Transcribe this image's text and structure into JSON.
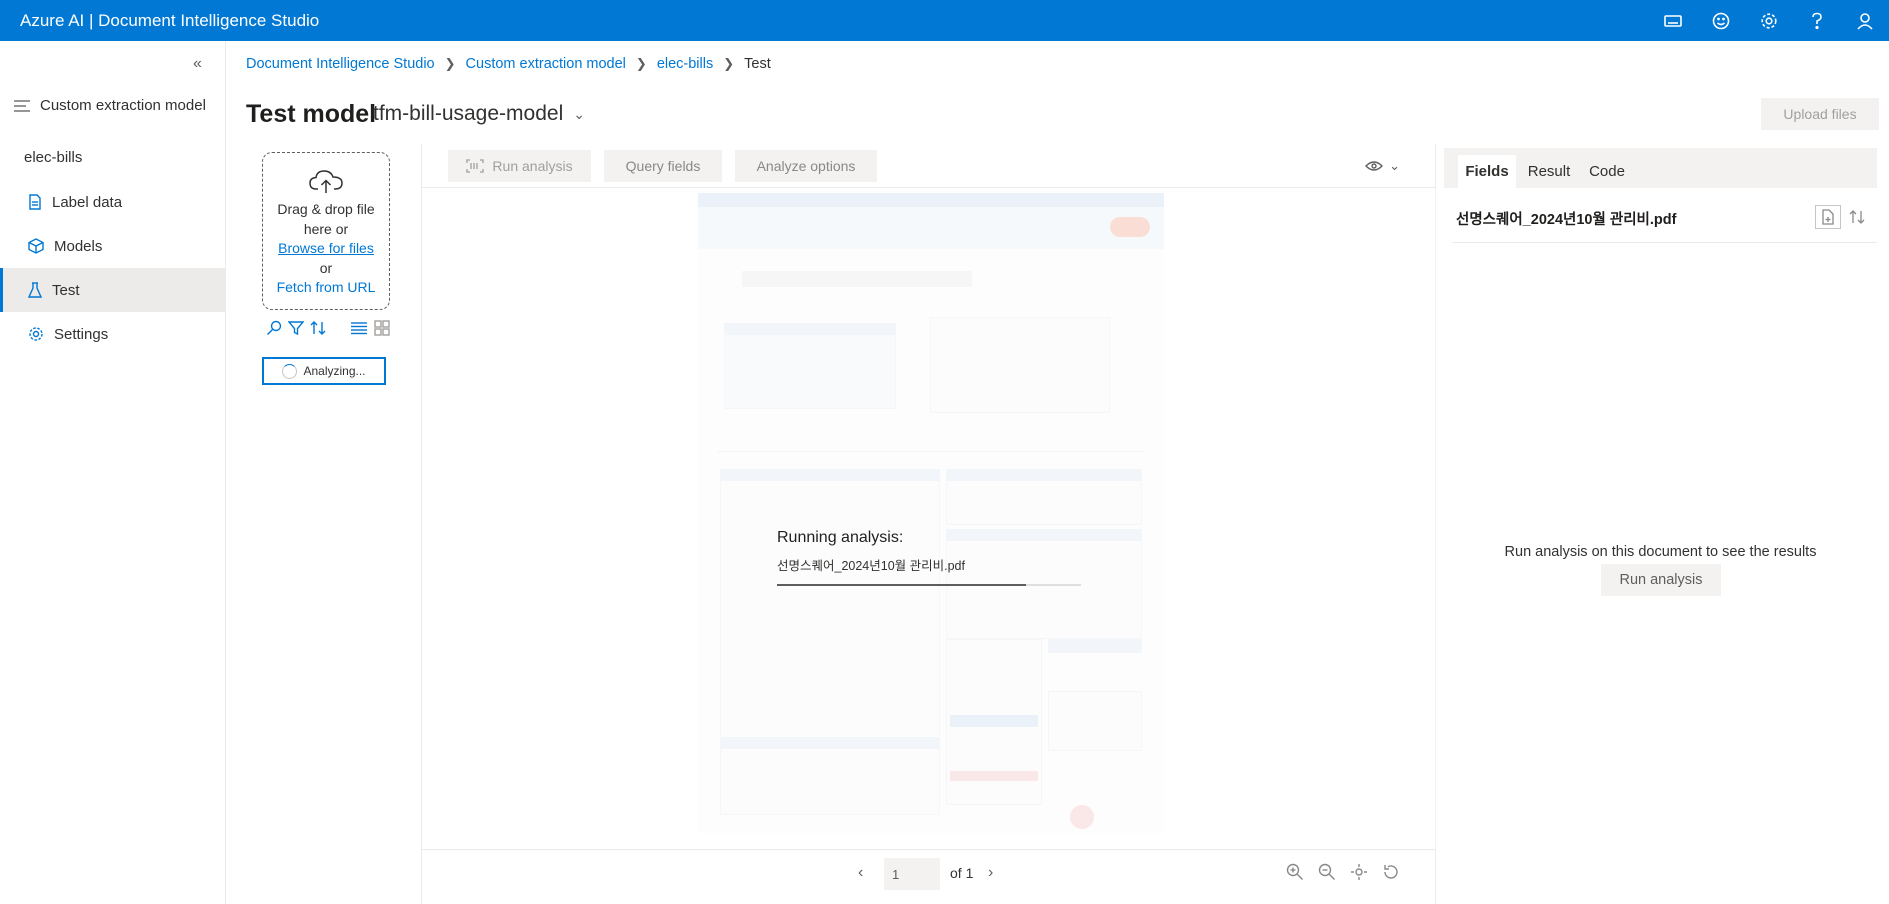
{
  "app": {
    "title": "Azure AI | Document Intelligence Studio"
  },
  "topbar_icons": [
    "keyboard-icon",
    "feedback-icon",
    "settings-icon",
    "help-icon",
    "account-icon"
  ],
  "sidebar": {
    "collapse_icon": "«",
    "header": "Custom extraction model",
    "project": "elec-bills",
    "items": [
      {
        "label": "Label data",
        "icon": "label-data-icon"
      },
      {
        "label": "Models",
        "icon": "cube-icon"
      },
      {
        "label": "Test",
        "icon": "flask-icon",
        "active": true
      },
      {
        "label": "Settings",
        "icon": "gear-icon"
      }
    ]
  },
  "breadcrumb": {
    "items": [
      "Document Intelligence Studio",
      "Custom extraction model",
      "elec-bills"
    ],
    "current": "Test"
  },
  "page": {
    "title": "Test model",
    "model": "tfm-bill-usage-model",
    "upload_label": "Upload files"
  },
  "dropzone": {
    "line1": "Drag & drop file",
    "line2": "here or",
    "browse": "Browse for files",
    "or": "or",
    "fetch": "Fetch from URL"
  },
  "status": {
    "analyzing": "Analyzing..."
  },
  "viewer": {
    "run_analysis": "Run analysis",
    "query_fields": "Query fields",
    "analyze_options": "Analyze options",
    "running_title": "Running analysis:",
    "running_file": "선명스퀘어_2024년10월 관리비.pdf",
    "progress_fraction": 0.82,
    "page_value": "1",
    "page_of": "of 1"
  },
  "results": {
    "tabs": [
      "Fields",
      "Result",
      "Code"
    ],
    "active_tab": "Fields",
    "filename": "선명스퀘어_2024년10월 관리비.pdf",
    "empty_message": "Run analysis on this document to see the results",
    "run_label": "Run analysis"
  },
  "colors": {
    "accent": "#0078d4",
    "topbar": "#0078d4"
  }
}
